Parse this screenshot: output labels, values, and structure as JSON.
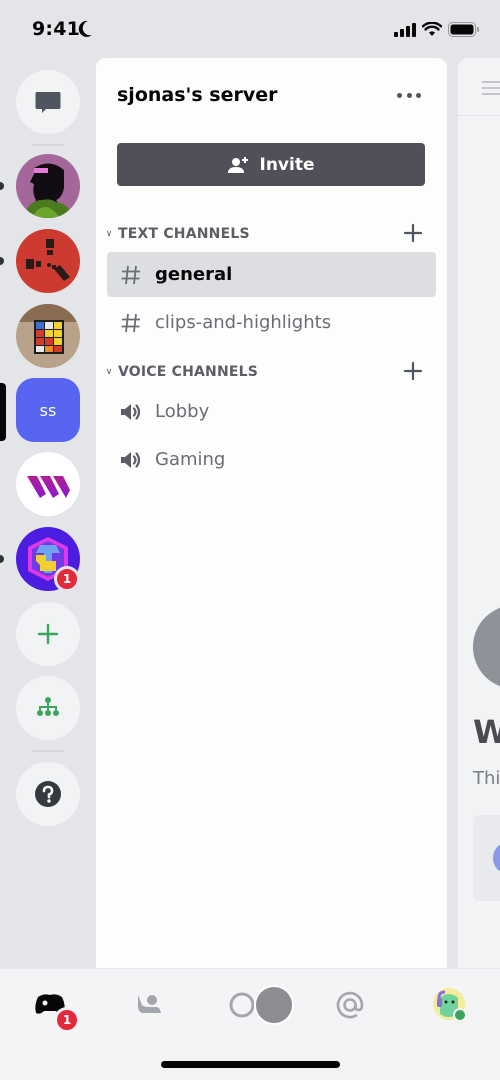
{
  "status_bar": {
    "time": "9:41",
    "focus_icon": "moon-icon",
    "icons": [
      "cellular-signal-icon",
      "wifi-icon",
      "battery-icon"
    ]
  },
  "server_rail": {
    "direct_messages": {
      "icon": "chat-bubble-icon",
      "label": "Direct Messages"
    },
    "servers": [
      {
        "name": "server-masked-figure",
        "avatar": "pink silhouette avatar",
        "unread": true
      },
      {
        "name": "server-rust",
        "avatar": "red rust logo",
        "unread": true
      },
      {
        "name": "server-rubiks-cube",
        "avatar": "rubiks cube photo",
        "unread": false
      },
      {
        "name": "sjonas's server",
        "initials": "ss",
        "selected": true,
        "color": "#5865f2"
      },
      {
        "name": "server-purple-w",
        "avatar": "purple W logo",
        "unread": false
      },
      {
        "name": "server-hex-logo",
        "avatar": "purple hex logo",
        "unread": true,
        "mentions": "1"
      }
    ],
    "add_server": {
      "icon": "plus-icon",
      "color": "#3ba55c"
    },
    "explore": {
      "icon": "hub-network-icon",
      "color": "#3ba55c"
    },
    "help": {
      "icon": "question-icon"
    }
  },
  "channel_panel": {
    "server_name": "sjonas's server",
    "more_icon": "ellipsis-icon",
    "invite_label": "Invite",
    "categories": [
      {
        "label": "TEXT CHANNELS",
        "channels": [
          {
            "name": "general",
            "type": "text",
            "active": true
          },
          {
            "name": "clips-and-highlights",
            "type": "text",
            "active": false
          }
        ]
      },
      {
        "label": "VOICE CHANNELS",
        "channels": [
          {
            "name": "Lobby",
            "type": "voice",
            "active": false
          },
          {
            "name": "Gaming",
            "type": "voice",
            "active": false
          }
        ]
      }
    ]
  },
  "peek_panel": {
    "title": "W",
    "subtitle": "Thi"
  },
  "tab_bar": {
    "tabs": [
      {
        "name": "servers",
        "icon": "discord-controller-icon",
        "badge": "1",
        "active": true
      },
      {
        "name": "friends",
        "icon": "friends-wave-icon"
      },
      {
        "name": "search",
        "icon": "search-icon"
      },
      {
        "name": "mentions",
        "icon": "at-sign-icon"
      },
      {
        "name": "profile",
        "icon": "user-avatar-icon"
      }
    ]
  },
  "colors": {
    "brand": "#5865f2",
    "green": "#3ba55c",
    "badge_red": "#e3293b",
    "invite_button": "#4f5058"
  }
}
